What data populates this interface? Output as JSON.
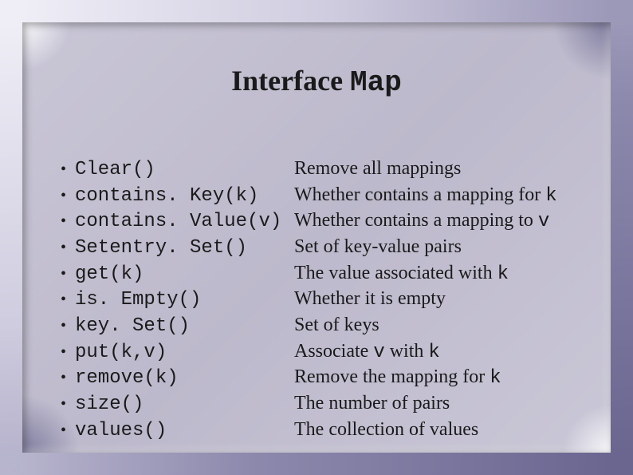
{
  "title": {
    "prefix": "Interface ",
    "mono": "Map"
  },
  "items": [
    {
      "method": "Clear()",
      "desc_pre": "Remove all mappings",
      "code": "",
      "desc_post": ""
    },
    {
      "method": "contains. Key(k)",
      "desc_pre": "Whether contains a mapping for ",
      "code": "k",
      "desc_post": ""
    },
    {
      "method": "contains. Value(v)",
      "desc_pre": "Whether contains a mapping to ",
      "code": "v",
      "desc_post": ""
    },
    {
      "method": "Setentry. Set()",
      "desc_pre": "Set of key-value pairs",
      "code": "",
      "desc_post": ""
    },
    {
      "method": "get(k)",
      "desc_pre": "The value associated with ",
      "code": "k",
      "desc_post": ""
    },
    {
      "method": "is. Empty()",
      "desc_pre": "Whether it is empty",
      "code": "",
      "desc_post": ""
    },
    {
      "method": "key. Set()",
      "desc_pre": "Set of keys",
      "code": "",
      "desc_post": ""
    },
    {
      "method": "put(k,v)",
      "desc_pre": "Associate ",
      "code": "v",
      "desc_post": " with ",
      "code2": "k"
    },
    {
      "method": "remove(k)",
      "desc_pre": "Remove the mapping for ",
      "code": "k",
      "desc_post": ""
    },
    {
      "method": "size()",
      "desc_pre": "The number of pairs",
      "code": "",
      "desc_post": ""
    },
    {
      "method": "values()",
      "desc_pre": "The collection of values",
      "code": "",
      "desc_post": ""
    }
  ]
}
